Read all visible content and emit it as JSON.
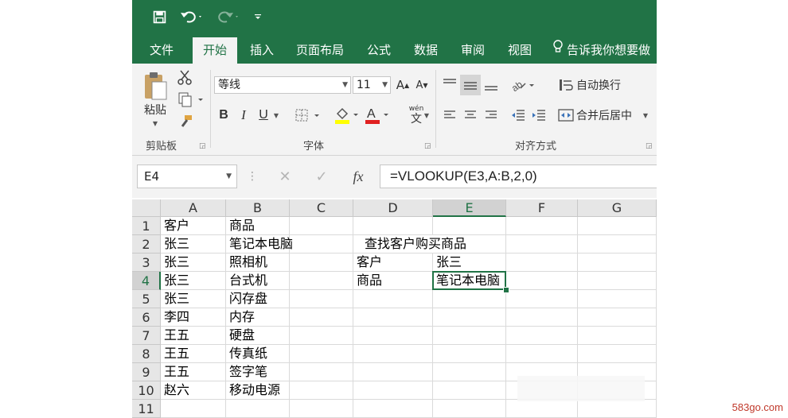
{
  "qat": {
    "save_icon": "save-icon",
    "undo_icon": "undo-icon",
    "redo_icon": "redo-icon",
    "customize_icon": "customize-qat-icon"
  },
  "tabs": [
    {
      "label": "文件"
    },
    {
      "label": "开始"
    },
    {
      "label": "插入"
    },
    {
      "label": "页面布局"
    },
    {
      "label": "公式"
    },
    {
      "label": "数据"
    },
    {
      "label": "审阅"
    },
    {
      "label": "视图"
    }
  ],
  "tell_me": "告诉我你想要做",
  "ribbon": {
    "clipboard": {
      "paste_label": "粘贴",
      "group_label": "剪贴板"
    },
    "font": {
      "font_name": "等线",
      "font_size": "11",
      "bold": "B",
      "italic": "I",
      "underline": "U",
      "group_label": "字体",
      "phonetic": "wén",
      "phonetic_char": "文",
      "increase": "A",
      "decrease": "A"
    },
    "alignment": {
      "wrap_text": "自动换行",
      "merge_center": "合并后居中",
      "group_label": "对齐方式"
    }
  },
  "formula_bar": {
    "name_box": "E4",
    "fx": "fx",
    "formula": "=VLOOKUP(E3,A:B,2,0)"
  },
  "sheet": {
    "columns": [
      "A",
      "B",
      "C",
      "D",
      "E",
      "F",
      "G"
    ],
    "rows": [
      "1",
      "2",
      "3",
      "4",
      "5",
      "6",
      "7",
      "8",
      "9",
      "10",
      "11"
    ],
    "cells": {
      "A1": "客户",
      "B1": "商品",
      "A2": "张三",
      "B2": "笔记本电脑",
      "D2": "查找客户购买商品",
      "A3": "张三",
      "B3": "照相机",
      "D3": "客户",
      "E3": "张三",
      "A4": "张三",
      "B4": "台式机",
      "D4": "商品",
      "E4": "笔记本电脑",
      "A5": "张三",
      "B5": "闪存盘",
      "A6": "李四",
      "B6": "内存",
      "A7": "王五",
      "B7": "硬盘",
      "A8": "王五",
      "B8": "传真纸",
      "A9": "王五",
      "B9": "签字笔",
      "A10": "赵六",
      "B10": "移动电源"
    },
    "selected_cell": "E4"
  },
  "watermark": "583go.com",
  "colors": {
    "accent": "#217346",
    "ribbon_bg": "#f3f3f3"
  }
}
